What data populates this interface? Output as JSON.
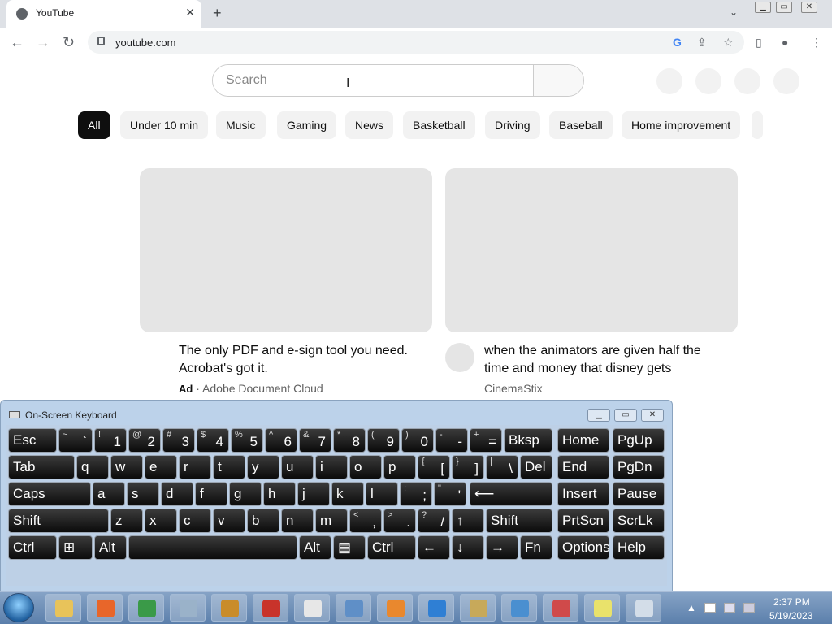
{
  "browser": {
    "tab_title": "YouTube",
    "url": "youtube.com",
    "close_glyph": "✕",
    "newtab_glyph": "+",
    "tabmenu_glyph": "⌄",
    "back_glyph": "←",
    "forward_glyph": "→",
    "reload_glyph": "↻",
    "google_glyph": "G",
    "share_glyph": "⇪",
    "star_glyph": "☆",
    "sidepanel_glyph": "▯",
    "profile_glyph": "●",
    "menu_glyph": "⋮"
  },
  "youtube": {
    "search_placeholder": "Search",
    "chips": [
      "All",
      "Under 10 min",
      "Music",
      "Gaming",
      "News",
      "Basketball",
      "Driving",
      "Baseball",
      "Home improvement"
    ],
    "videos": [
      {
        "title_line1": "The only PDF and e-sign tool you need.",
        "title_line2": "Acrobat's got it.",
        "ad_label": "Ad",
        "separator": "·",
        "channel": "Adobe Document Cloud"
      },
      {
        "title_line1": "when the animators are given half the",
        "title_line2": "time and money that disney gets",
        "channel": "CinemaStix"
      }
    ]
  },
  "osk": {
    "title": "On-Screen Keyboard",
    "min": "▁",
    "max": "▭",
    "close": "✕",
    "row1": [
      {
        "main": "Esc"
      },
      {
        "shift": "~",
        "base": "`"
      },
      {
        "shift": "!",
        "base": "1"
      },
      {
        "shift": "@",
        "base": "2"
      },
      {
        "shift": "#",
        "base": "3"
      },
      {
        "shift": "$",
        "base": "4"
      },
      {
        "shift": "%",
        "base": "5"
      },
      {
        "shift": "^",
        "base": "6"
      },
      {
        "shift": "&",
        "base": "7"
      },
      {
        "shift": "*",
        "base": "8"
      },
      {
        "shift": "(",
        "base": "9"
      },
      {
        "shift": ")",
        "base": "0"
      },
      {
        "shift": "-",
        "base": "-"
      },
      {
        "shift": "+",
        "base": "="
      },
      {
        "main": "Bksp"
      },
      {
        "main": "Home"
      },
      {
        "main": "PgUp"
      }
    ],
    "row2": [
      {
        "main": "Tab"
      },
      {
        "main": "q"
      },
      {
        "main": "w"
      },
      {
        "main": "e"
      },
      {
        "main": "r"
      },
      {
        "main": "t"
      },
      {
        "main": "y"
      },
      {
        "main": "u"
      },
      {
        "main": "i"
      },
      {
        "main": "o"
      },
      {
        "main": "p"
      },
      {
        "shift": "{",
        "base": "["
      },
      {
        "shift": "}",
        "base": "]"
      },
      {
        "shift": "|",
        "base": "\\"
      },
      {
        "main": "Del"
      },
      {
        "main": "End"
      },
      {
        "main": "PgDn"
      }
    ],
    "row3": [
      {
        "main": "Caps"
      },
      {
        "main": "a"
      },
      {
        "main": "s"
      },
      {
        "main": "d"
      },
      {
        "main": "f"
      },
      {
        "main": "g"
      },
      {
        "main": "h"
      },
      {
        "main": "j"
      },
      {
        "main": "k"
      },
      {
        "main": "l"
      },
      {
        "shift": ":",
        "base": ";"
      },
      {
        "shift": "\"",
        "base": "'"
      },
      {
        "main": "⟵"
      },
      {
        "main": "Insert"
      },
      {
        "main": "Pause"
      }
    ],
    "row4": [
      {
        "main": "Shift"
      },
      {
        "main": "z"
      },
      {
        "main": "x"
      },
      {
        "main": "c"
      },
      {
        "main": "v"
      },
      {
        "main": "b"
      },
      {
        "main": "n"
      },
      {
        "main": "m"
      },
      {
        "shift": "<",
        "base": ","
      },
      {
        "shift": ">",
        "base": "."
      },
      {
        "shift": "?",
        "base": "/"
      },
      {
        "main": "↑"
      },
      {
        "main": "Shift"
      },
      {
        "main": "PrtScn"
      },
      {
        "main": "ScrLk"
      }
    ],
    "row5": [
      {
        "main": "Ctrl"
      },
      {
        "main": "⊞"
      },
      {
        "main": "Alt"
      },
      {
        "main": ""
      },
      {
        "main": "Alt"
      },
      {
        "main": "▤"
      },
      {
        "main": "Ctrl"
      },
      {
        "main": "←"
      },
      {
        "main": "↓"
      },
      {
        "main": "→"
      },
      {
        "main": "Fn"
      },
      {
        "main": "Options"
      },
      {
        "main": "Help"
      }
    ]
  },
  "taskbar": {
    "time": "2:37 PM",
    "date": "5/19/2023",
    "tray_up": "▲",
    "apps": [
      {
        "name": "explorer",
        "color": "#e8c35a"
      },
      {
        "name": "firefox",
        "color": "#e8662a"
      },
      {
        "name": "chrome",
        "color": "#3a9a48"
      },
      {
        "name": "calculator",
        "color": "#9ab2c9"
      },
      {
        "name": "freecell",
        "color": "#c98c2a"
      },
      {
        "name": "hearts",
        "color": "#c8332b"
      },
      {
        "name": "solitaire",
        "color": "#e7e7e7"
      },
      {
        "name": "control-panel",
        "color": "#5f8fc7"
      },
      {
        "name": "media-player",
        "color": "#e9882e"
      },
      {
        "name": "internet-explorer",
        "color": "#2f7fd4"
      },
      {
        "name": "paint",
        "color": "#c7a95a"
      },
      {
        "name": "mail",
        "color": "#4a8fd0"
      },
      {
        "name": "snipping-tool",
        "color": "#d04a4a"
      },
      {
        "name": "sticky-notes",
        "color": "#e9e26b"
      },
      {
        "name": "notepad",
        "color": "#d3dde8"
      }
    ]
  }
}
